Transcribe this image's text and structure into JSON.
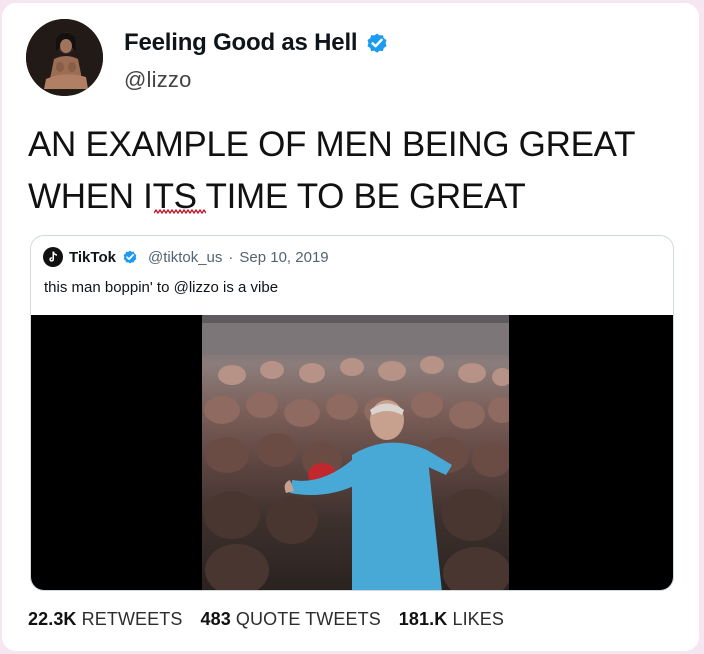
{
  "author": {
    "display_name": "Feeling Good as Hell",
    "handle": "@lizzo",
    "verified": true,
    "verified_color": "#1d9bf0"
  },
  "tweet": {
    "line1": "AN EXAMPLE OF MEN BEING GREAT",
    "line2": "WHEN ITS TIME TO BE GREAT"
  },
  "quoted_tweet": {
    "display_name": "TikTok",
    "verified": true,
    "handle": "@tiktok_us",
    "separator": "·",
    "date": "Sep 10, 2019",
    "text": "this man boppin' to @lizzo is a vibe",
    "logo_icon": "tiktok-logo-icon"
  },
  "stats": {
    "retweets_count": "22.3K",
    "retweets_label": "RETWEETS",
    "quotes_count": "483",
    "quotes_label": "QUOTE TWEETS",
    "likes_count": "181.K",
    "likes_label": "LIKES"
  },
  "colors": {
    "background": "#f6e6f1",
    "card": "#ffffff",
    "border": "#cfd9de",
    "spellcheck": "#d0021b"
  }
}
